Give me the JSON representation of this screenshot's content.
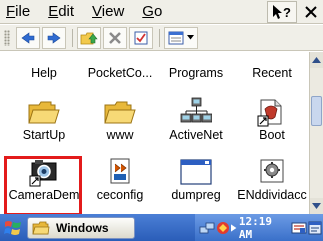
{
  "menubar": {
    "items": [
      {
        "accel": "F",
        "rest": "ile"
      },
      {
        "accel": "E",
        "rest": "dit"
      },
      {
        "accel": "V",
        "rest": "iew"
      },
      {
        "accel": "G",
        "rest": "o"
      }
    ],
    "help_icon": "help-question-icon",
    "close_icon": "close-icon"
  },
  "toolbar": {
    "icons": [
      "back-arrow-icon",
      "forward-arrow-icon",
      "up-folder-icon",
      "delete-icon",
      "properties-icon",
      "view-menu-icon"
    ]
  },
  "files": [
    {
      "label": "Help",
      "icon": "none"
    },
    {
      "label": "PocketCo...",
      "icon": "none"
    },
    {
      "label": "Programs",
      "icon": "none"
    },
    {
      "label": "Recent",
      "icon": "none"
    },
    {
      "label": "StartUp",
      "icon": "folder-icon"
    },
    {
      "label": "www",
      "icon": "folder-icon"
    },
    {
      "label": "ActiveNet",
      "icon": "network-icon"
    },
    {
      "label": "Boot",
      "icon": "app-icon"
    },
    {
      "label": "CameraDem",
      "icon": "camera-icon"
    },
    {
      "label": "ceconfig",
      "icon": "document-icon"
    },
    {
      "label": "dumpreg",
      "icon": "window-icon"
    },
    {
      "label": "ENddividacc",
      "icon": "gear-app-icon"
    }
  ],
  "taskbar": {
    "task_label": "Windows",
    "clock": "12:19 AM"
  },
  "colors": {
    "selection_border": "#e31b1b",
    "taskbar_blue": "#2a5db8"
  }
}
